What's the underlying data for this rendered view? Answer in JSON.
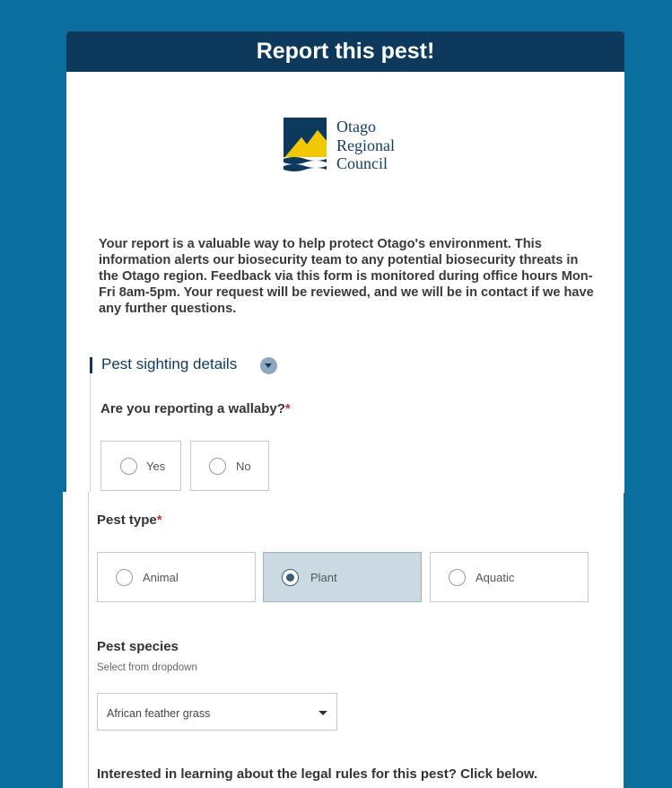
{
  "header": {
    "title": "Report this pest!"
  },
  "logo": {
    "line1": "Otago",
    "line2": "Regional",
    "line3": "Council"
  },
  "intro": {
    "text": "Your report is a valuable way to help protect Otago's environment. This information alerts our biosecurity team to any potential biosecurity threats in the Otago region. Feedback via this form is monitored during office hours Mon-Fri 8am-5pm. Your request will be reviewed, and we will be in contact if we have any further questions."
  },
  "section": {
    "title": "Pest sighting details"
  },
  "wallaby": {
    "question": "Are you reporting a wallaby?",
    "required_mark": "*",
    "options": [
      {
        "label": "Yes",
        "selected": false
      },
      {
        "label": "No",
        "selected": false
      }
    ]
  },
  "pest_type": {
    "question": "Pest type",
    "required_mark": "*",
    "options": [
      {
        "label": "Animal",
        "selected": false
      },
      {
        "label": "Plant",
        "selected": true
      },
      {
        "label": "Aquatic",
        "selected": false
      }
    ]
  },
  "pest_species": {
    "label": "Pest species",
    "helper": "Select from dropdown",
    "value": "African feather grass"
  },
  "legal": {
    "text": "Interested in learning about the legal rules for this pest? Click below."
  },
  "colors": {
    "page_bg": "#0a6f9e",
    "header_bg": "#0d3a5c",
    "selected_bg": "#cbd9e2",
    "required": "#c0392b"
  }
}
